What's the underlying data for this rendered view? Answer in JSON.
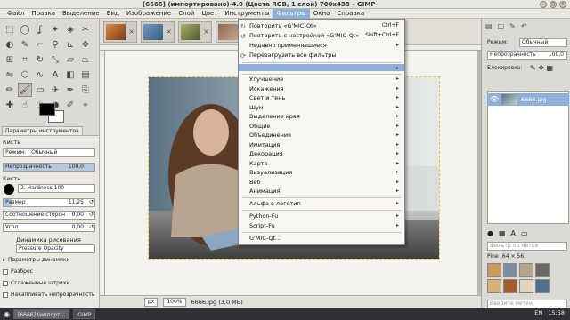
{
  "window": {
    "title": "[6666] (импортировано)-4.0 (Цвета RGB, 1 слой) 700x438 – GIMP"
  },
  "menubar": [
    "Файл",
    "Правка",
    "Выделение",
    "Вид",
    "Изображение",
    "Слой",
    "Цвет",
    "Инструменты",
    "Фильтры",
    "Окна",
    "Справка"
  ],
  "active_menu": "Фильтры",
  "filters_menu": {
    "top": [
      {
        "label": "Повторить «G'MIC-Qt»",
        "shortcut": "Ctrl+F"
      },
      {
        "label": "Повторить с настройкой «G'MIC-Qt»",
        "shortcut": "Shift+Ctrl+F"
      },
      {
        "label": "Недавно применявшиеся",
        "shortcut": ""
      },
      {
        "label": "Перезагрузить все фильтры",
        "shortcut": ""
      }
    ],
    "submenus": [
      "Улучшение",
      "Искажения",
      "Свет и тень",
      "Шум",
      "Выделение края",
      "Общие",
      "Объединение",
      "Имитация",
      "Декорация",
      "Карта",
      "Визуализация",
      "Веб",
      "Анимация"
    ],
    "alpha": "Альфа в логотип",
    "fu": [
      "Python-Fu",
      "Script-Fu"
    ],
    "gmic": "G'MIC-Qt..."
  },
  "tool_options": {
    "tab": "Параметры инструментов",
    "tool_name": "Кисть",
    "mode_label": "Режим:",
    "mode_value": "Обычный",
    "opacity_label": "Непрозрачность",
    "opacity_value": "100,0",
    "opacity_fraction": 1.0,
    "brush_label": "Кисть",
    "brush_value": "2. Hardness 100",
    "size_label": "Размер",
    "size_value": "11,25",
    "size_fraction": 0.09,
    "aspect_label": "Соотношение сторон",
    "aspect_value": "0,00",
    "angle_label": "Угол",
    "angle_value": "0,00",
    "dynamics_label": "Динамика рисования",
    "dynamics_value": "Pressure Opacity",
    "checks": [
      "Параметры динамики",
      "Разброс",
      "Сглаженные штрихи",
      "Накапливать непрозрачность"
    ]
  },
  "statusbar": {
    "unit": "px",
    "zoom": "100%",
    "file": "6666.jpg (3,0 МБ)"
  },
  "right_panel": {
    "mode_label": "Режим:",
    "mode_value": "Обычный",
    "opacity_label": "Непрозрачность",
    "opacity_value": "100,0",
    "lock_label": "Блокировка:",
    "layer_name": "6666.jpg",
    "patterns_filter": "Фильтр по метке",
    "pattern_name": "Pine (64 × 56)",
    "tags_placeholder": "Введите метки"
  },
  "taskbar": {
    "tasks": [
      "[6666] (импорт...",
      "GIMP"
    ],
    "clock": "15:58",
    "lang": "EN"
  },
  "colors": {
    "highlight": "#8db0d8",
    "fg": "#000000",
    "bg": "#ffffff"
  }
}
